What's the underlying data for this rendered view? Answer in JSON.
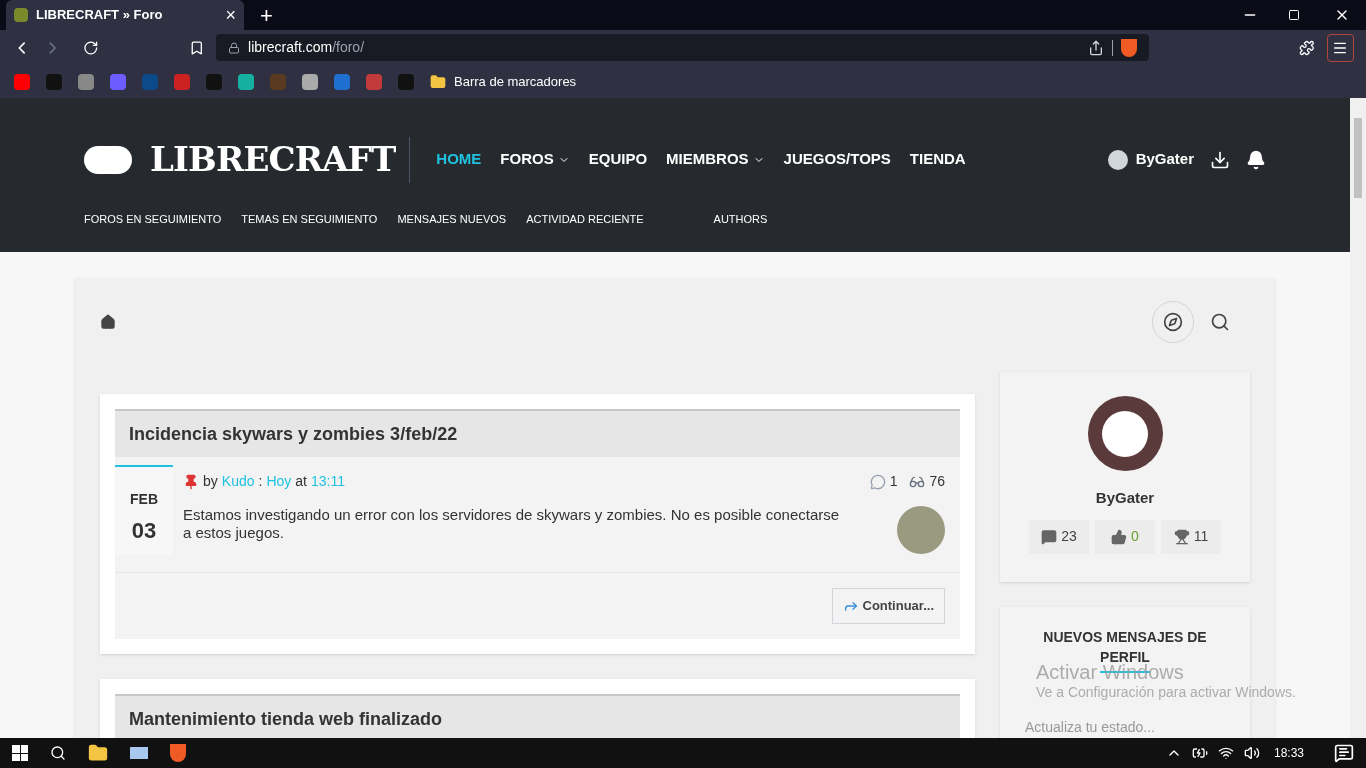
{
  "browser": {
    "tab": {
      "title": "LIBRECRAFT » Foro",
      "close": "×"
    },
    "new_tab": "+",
    "url_host": "librecraft.com",
    "url_path": "/foro/",
    "bookmarks_folder": "Barra de marcadores"
  },
  "site": {
    "logo": "LIBRECRAFT",
    "nav": [
      {
        "label": "HOME",
        "selected": true,
        "dropdown": false
      },
      {
        "label": "FOROS",
        "selected": false,
        "dropdown": true
      },
      {
        "label": "EQUIPO",
        "selected": false,
        "dropdown": false
      },
      {
        "label": "MIEMBROS",
        "selected": false,
        "dropdown": true
      },
      {
        "label": "JUEGOS/TOPS",
        "selected": false,
        "dropdown": false
      },
      {
        "label": "TIENDA",
        "selected": false,
        "dropdown": false
      }
    ],
    "user": "ByGater",
    "subnav": [
      "FOROS EN SEGUIMIENTO",
      "TEMAS EN SEGUIMIENTO",
      "MENSAJES NUEVOS",
      "ACTIVIDAD RECIENTE",
      "AUTHORS"
    ]
  },
  "threads": [
    {
      "title": "Incidencia skywars y zombies 3/feb/22",
      "month": "FEB",
      "day": "03",
      "by": "by",
      "author": "Kudo",
      "sep": ":",
      "date": "Hoy",
      "at": "at",
      "time": "13:11",
      "replies": "1",
      "views": "76",
      "body": "Estamos investigando un error con los servidores de skywars y zombies. No es posible conectarse a estos juegos.",
      "more": "Continuar..."
    },
    {
      "title": "Mantenimiento tienda web finalizado"
    }
  ],
  "profile": {
    "name": "ByGater",
    "stats": [
      {
        "kind": "messages",
        "value": "23"
      },
      {
        "kind": "likes",
        "value": "0"
      },
      {
        "kind": "trophies",
        "value": "11"
      }
    ]
  },
  "profile_posts": {
    "title": "NUEVOS MENSAJES DE PERFIL",
    "placeholder": "Actualiza tu estado..."
  },
  "os_watermark": {
    "title": "Activar Windows",
    "text": "Ve a Configuración para activar Windows."
  },
  "taskbar": {
    "time": "18:33"
  }
}
